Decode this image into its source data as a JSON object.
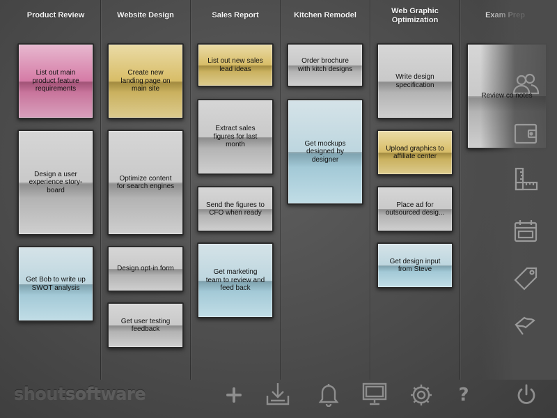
{
  "board": {
    "columns": [
      {
        "title": "Product Review",
        "cards": [
          {
            "text": "List out main product feature requirements",
            "color": "pink"
          },
          {
            "text": "Design a user experience story-board",
            "color": "white"
          },
          {
            "text": "Get Bob to write up SWOT analysis",
            "color": "blue"
          }
        ]
      },
      {
        "title": "Website Design",
        "cards": [
          {
            "text": "Create new landing page on main site",
            "color": "yellow"
          },
          {
            "text": "Optimize content for search engines",
            "color": "white"
          },
          {
            "text": "Design opt-in form",
            "color": "white"
          },
          {
            "text": "Get user testing feedback",
            "color": "white"
          }
        ]
      },
      {
        "title": "Sales Report",
        "cards": [
          {
            "text": "List out new sales lead ideas",
            "color": "yellow"
          },
          {
            "text": "Extract sales figures for last month",
            "color": "white"
          },
          {
            "text": "Send the figures to CFO when ready",
            "color": "white"
          },
          {
            "text": "Get marketing team to review and feed back",
            "color": "blue"
          }
        ]
      },
      {
        "title": "Kitchen Remodel",
        "cards": [
          {
            "text": "Order brochure with kitch designs",
            "color": "white"
          },
          {
            "text": "Get mockups designed by designer",
            "color": "blue"
          }
        ]
      },
      {
        "title": "Web Graphic Optimization",
        "cards": [
          {
            "text": "Write design specification",
            "color": "white"
          },
          {
            "text": "Upload graphics to affiliate center",
            "color": "yellow"
          },
          {
            "text": "Place ad for outsourced desig...",
            "color": "white"
          },
          {
            "text": "Get design input from Steve",
            "color": "blue"
          }
        ]
      },
      {
        "title": "Exam Prep",
        "cards": [
          {
            "text": "Review co notes",
            "color": "white"
          }
        ]
      }
    ]
  },
  "side_icons": [
    "contacts-icon",
    "wallet-icon",
    "ruler-icon",
    "calendar-icon",
    "tag-icon",
    "flag-icon"
  ],
  "toolbar": {
    "logo_shout": "shout",
    "logo_software": "software",
    "help_label": "?",
    "icons": [
      "add-icon",
      "download-icon",
      "bell-icon",
      "monitor-icon",
      "gear-icon",
      "help-icon",
      "power-icon"
    ]
  },
  "colors": {
    "pink": "#d57ba6",
    "yellow": "#d8bd67",
    "white": "#cccccc",
    "blue": "#bdd6df",
    "background": "#555555",
    "icon": "#9a9a9a"
  }
}
